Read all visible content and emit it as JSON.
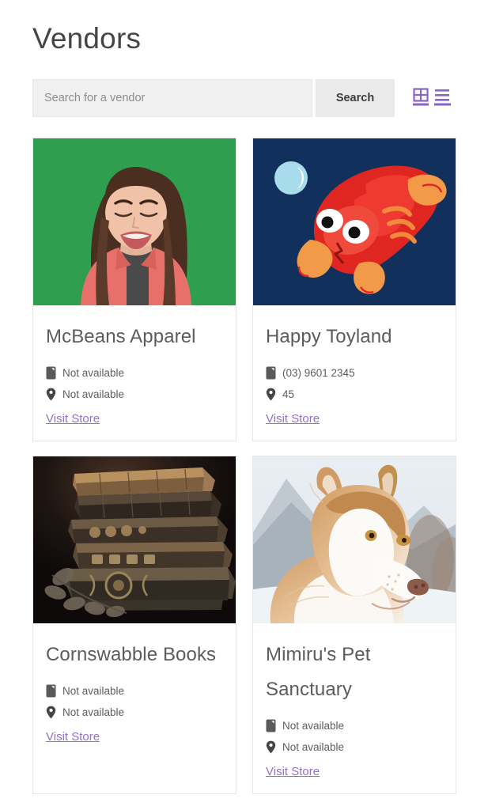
{
  "header": {
    "title": "Vendors"
  },
  "search": {
    "placeholder": "Search for a vendor",
    "value": "",
    "button_label": "Search"
  },
  "view_toggles": [
    {
      "name": "grid-view-toggle",
      "icon": "grid-icon",
      "active": true,
      "color": "#8a63c4"
    },
    {
      "name": "list-view-toggle",
      "icon": "list-icon",
      "active": true,
      "color": "#8a63c4"
    }
  ],
  "colors": {
    "link": "#9370c9",
    "accent": "#8a63c4",
    "title": "#454545",
    "card_title": "#5c5c5c",
    "meta_text": "#5d5d5d",
    "search_bg": "#f0f0f0",
    "button_bg": "#eaeaea",
    "card_border": "#e6e6e6"
  },
  "vendors": [
    {
      "name": "McBeans Apparel",
      "image_alt": "crying-woman-on-green-background",
      "phone": "Not available",
      "location": "Not available",
      "link_label": "Visit Store"
    },
    {
      "name": "Happy Toyland",
      "image_alt": "red-clay-lobster-toy-on-navy-background",
      "phone": "(03) 9601 2345",
      "location": "45",
      "link_label": "Visit Store"
    },
    {
      "name": "Cornswabble Books",
      "image_alt": "stack-of-antique-books-dark",
      "phone": "Not available",
      "location": "Not available",
      "link_label": "Visit Store"
    },
    {
      "name": "Mimiru's Pet Sanctuary",
      "image_alt": "siberian-husky-dog-in-snow",
      "phone": "Not available",
      "location": "Not available",
      "link_label": "Visit Store"
    }
  ]
}
